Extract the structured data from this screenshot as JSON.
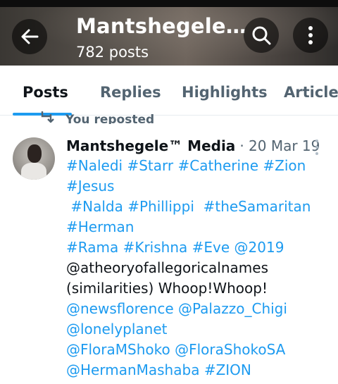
{
  "header": {
    "title": "Mantshegele…",
    "post_count": "782 posts"
  },
  "tabs": [
    {
      "label": "Posts",
      "active": true
    },
    {
      "label": "Replies",
      "active": false
    },
    {
      "label": "Highlights",
      "active": false
    },
    {
      "label": "Articles",
      "active": false
    }
  ],
  "repost_label": "You reposted",
  "post": {
    "author": "Mantshegele™ Media",
    "date": "· 20 Mar 19",
    "lines": [
      [
        {
          "t": "#Naledi",
          "tag": true
        },
        {
          "t": " ",
          "tag": false
        },
        {
          "t": "#Starr",
          "tag": true
        },
        {
          "t": " ",
          "tag": false
        },
        {
          "t": "#Catherine",
          "tag": true
        },
        {
          "t": " ",
          "tag": false
        },
        {
          "t": "#Zion",
          "tag": true
        }
      ],
      [
        {
          "t": "#Jesus",
          "tag": true
        }
      ],
      [
        {
          "t": " ",
          "tag": false
        },
        {
          "t": "#Nalda",
          "tag": true
        },
        {
          "t": " ",
          "tag": false
        },
        {
          "t": "#Phillippi",
          "tag": true
        },
        {
          "t": "  ",
          "tag": false
        },
        {
          "t": "#theSamaritan",
          "tag": true
        }
      ],
      [
        {
          "t": "#Herman",
          "tag": true
        }
      ],
      [
        {
          "t": "#Rama",
          "tag": true
        },
        {
          "t": " ",
          "tag": false
        },
        {
          "t": "#Krishna",
          "tag": true
        },
        {
          "t": " ",
          "tag": false
        },
        {
          "t": "#Eve",
          "tag": true
        },
        {
          "t": " ",
          "tag": false
        },
        {
          "t": "@2019",
          "tag": true
        }
      ],
      [
        {
          "t": "@atheoryofallegoricalnames",
          "tag": false
        }
      ],
      [
        {
          "t": "(similarities) Whoop!Whoop!",
          "tag": false
        }
      ],
      [
        {
          "t": "@newsflorence",
          "tag": true
        },
        {
          "t": " ",
          "tag": false
        },
        {
          "t": "@Palazzo_Chigi",
          "tag": true
        }
      ],
      [
        {
          "t": "@lonelyplanet",
          "tag": true
        }
      ],
      [
        {
          "t": "@FloraMShoko",
          "tag": true
        },
        {
          "t": " ",
          "tag": false
        },
        {
          "t": "@FloraShokoSA",
          "tag": true
        }
      ],
      [
        {
          "t": "@HermanMashaba",
          "tag": true
        },
        {
          "t": " ",
          "tag": false
        },
        {
          "t": "#ZION",
          "tag": true
        }
      ]
    ]
  },
  "icons": {
    "back": "arrow-left-icon",
    "search": "search-icon",
    "more": "more-vertical-icon",
    "repost": "repost-icon",
    "post_more": "more-vertical-icon"
  },
  "colors": {
    "accent": "#1d9bf0",
    "text": "#0f1419",
    "secondary": "#536471"
  }
}
